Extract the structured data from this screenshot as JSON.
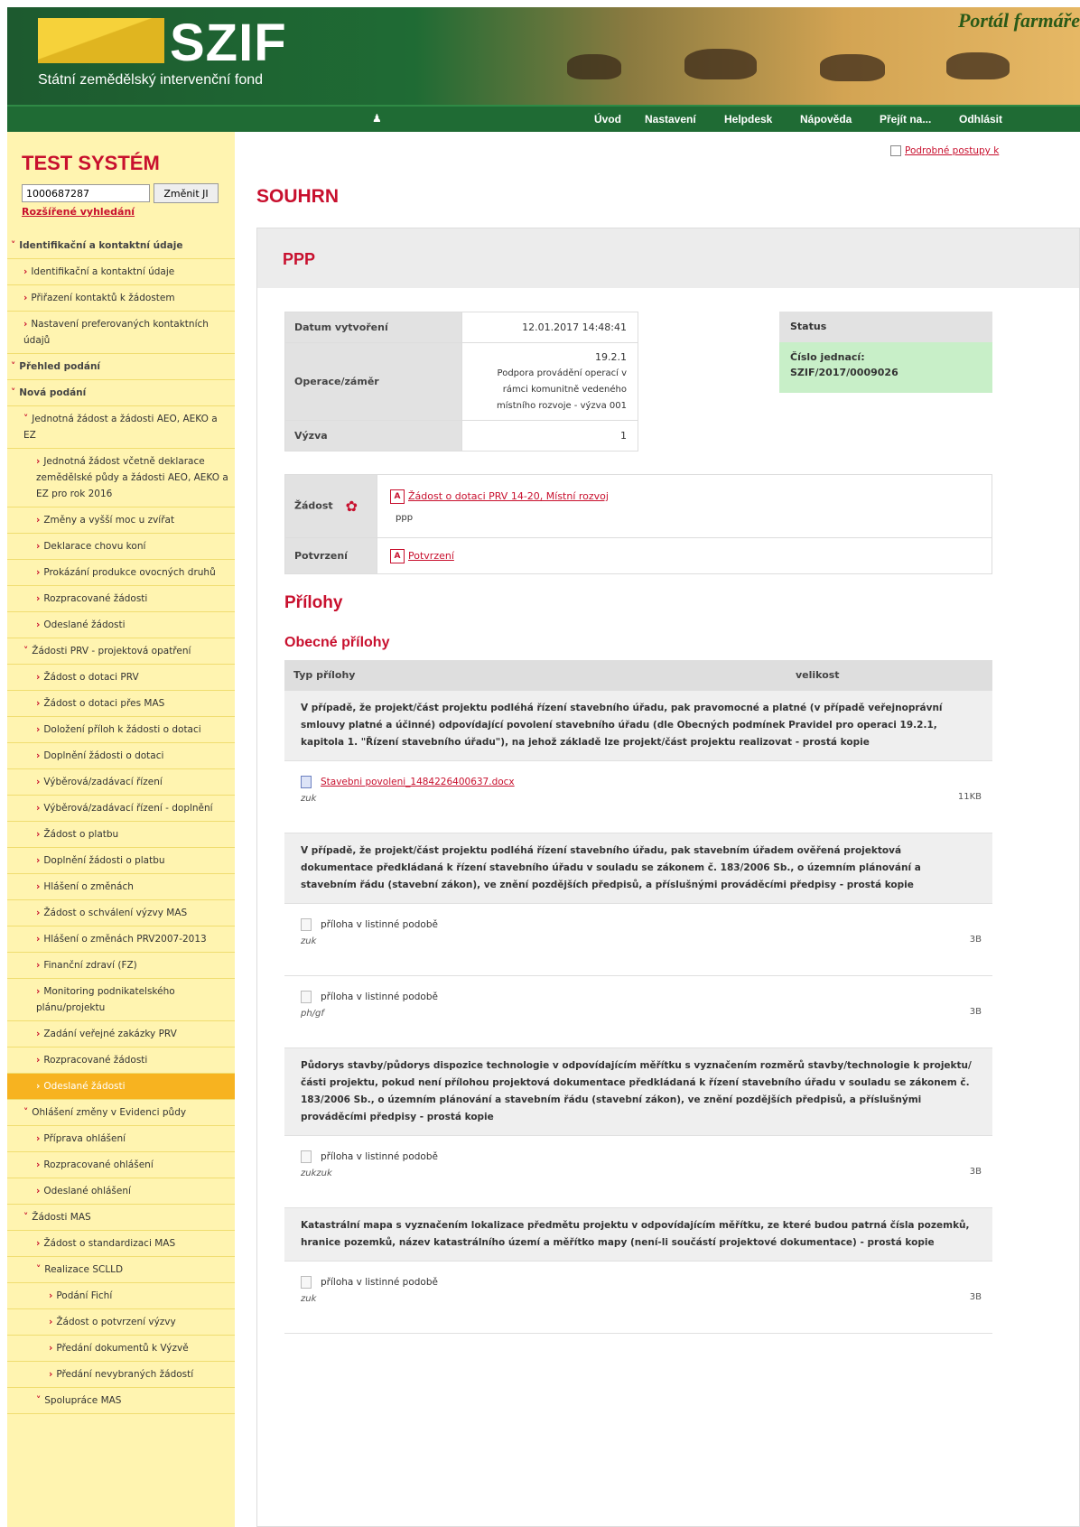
{
  "header": {
    "logo": "SZIF",
    "logo_subtitle": "Státní zemědělský intervenční fond",
    "portal_title": "Portál farmáře"
  },
  "nav": {
    "items": [
      "Úvod",
      "Nastavení",
      "Helpdesk",
      "Nápověda",
      "Přejít na...",
      "Odhlásit"
    ]
  },
  "sidebar": {
    "title": "TEST SYSTÉM",
    "id_value": "1000687287",
    "change_button": "Změnit JI",
    "advanced_search": "Rozšířené vyhledání",
    "menu": [
      {
        "label": "Identifikační a kontaktní údaje",
        "level": 0,
        "chev": "v",
        "active": false
      },
      {
        "label": "Identifikační a kontaktní údaje",
        "level": 1,
        "chev": ">",
        "active": false
      },
      {
        "label": "Přiřazení kontaktů k žádostem",
        "level": 1,
        "chev": ">",
        "active": false
      },
      {
        "label": "Nastavení preferovaných kontaktních údajů",
        "level": 1,
        "chev": ">",
        "active": false
      },
      {
        "label": "Přehled podání",
        "level": 0,
        "chev": "v",
        "active": false
      },
      {
        "label": "Nová podání",
        "level": 0,
        "chev": "v",
        "active": false
      },
      {
        "label": "Jednotná žádost a žádosti AEO, AEKO a EZ",
        "level": 1,
        "chev": "v",
        "active": false
      },
      {
        "label": "Jednotná žádost včetně deklarace zemědělské půdy a žádosti AEO, AEKO a EZ pro rok 2016",
        "level": 2,
        "chev": ">",
        "active": false
      },
      {
        "label": "Změny a vyšší moc u zvířat",
        "level": 2,
        "chev": ">",
        "active": false
      },
      {
        "label": "Deklarace chovu koní",
        "level": 2,
        "chev": ">",
        "active": false
      },
      {
        "label": "Prokázání produkce ovocných druhů",
        "level": 2,
        "chev": ">",
        "active": false
      },
      {
        "label": "Rozpracované žádosti",
        "level": 2,
        "chev": ">",
        "active": false
      },
      {
        "label": "Odeslané žádosti",
        "level": 2,
        "chev": ">",
        "active": false
      },
      {
        "label": "Žádosti PRV - projektová opatření",
        "level": 1,
        "chev": "v",
        "active": false
      },
      {
        "label": "Žádost o dotaci PRV",
        "level": 2,
        "chev": ">",
        "active": false
      },
      {
        "label": "Žádost o dotaci přes MAS",
        "level": 2,
        "chev": ">",
        "active": false
      },
      {
        "label": "Doložení příloh k žádosti o dotaci",
        "level": 2,
        "chev": ">",
        "active": false
      },
      {
        "label": "Doplnění žádosti o dotaci",
        "level": 2,
        "chev": ">",
        "active": false
      },
      {
        "label": "Výběrová/zadávací řízení",
        "level": 2,
        "chev": ">",
        "active": false
      },
      {
        "label": "Výběrová/zadávací řízení - doplnění",
        "level": 2,
        "chev": ">",
        "active": false
      },
      {
        "label": "Žádost o platbu",
        "level": 2,
        "chev": ">",
        "active": false
      },
      {
        "label": "Doplnění žádosti o platbu",
        "level": 2,
        "chev": ">",
        "active": false
      },
      {
        "label": "Hlášení o změnách",
        "level": 2,
        "chev": ">",
        "active": false
      },
      {
        "label": "Žádost o schválení výzvy MAS",
        "level": 2,
        "chev": ">",
        "active": false
      },
      {
        "label": "Hlášení o změnách PRV2007-2013",
        "level": 2,
        "chev": ">",
        "active": false
      },
      {
        "label": "Finanční zdraví (FZ)",
        "level": 2,
        "chev": ">",
        "active": false
      },
      {
        "label": "Monitoring podnikatelského plánu/projektu",
        "level": 2,
        "chev": ">",
        "active": false
      },
      {
        "label": "Zadání veřejné zakázky PRV",
        "level": 2,
        "chev": ">",
        "active": false
      },
      {
        "label": "Rozpracované žádosti",
        "level": 2,
        "chev": ">",
        "active": false
      },
      {
        "label": "Odeslané žádosti",
        "level": 2,
        "chev": ">",
        "active": true
      },
      {
        "label": "Ohlášení změny v Evidenci půdy",
        "level": 1,
        "chev": "v",
        "active": false
      },
      {
        "label": "Příprava ohlášení",
        "level": 2,
        "chev": ">",
        "active": false
      },
      {
        "label": "Rozpracované ohlášení",
        "level": 2,
        "chev": ">",
        "active": false
      },
      {
        "label": "Odeslané ohlášení",
        "level": 2,
        "chev": ">",
        "active": false
      },
      {
        "label": "Žádosti MAS",
        "level": 1,
        "chev": "v",
        "active": false
      },
      {
        "label": "Žádost o standardizaci MAS",
        "level": 2,
        "chev": ">",
        "active": false
      },
      {
        "label": "Realizace SCLLD",
        "level": 2,
        "chev": "v",
        "active": false
      },
      {
        "label": "Podání Fichí",
        "level": 3,
        "chev": ">",
        "active": false
      },
      {
        "label": "Žádost o potvrzení výzvy",
        "level": 3,
        "chev": ">",
        "active": false
      },
      {
        "label": "Předání dokumentů k Výzvě",
        "level": 3,
        "chev": ">",
        "active": false
      },
      {
        "label": "Předání nevybraných žádostí",
        "level": 3,
        "chev": ">",
        "active": false
      },
      {
        "label": "Spolupráce MAS",
        "level": 2,
        "chev": "v",
        "active": false
      }
    ]
  },
  "main": {
    "detail_link": "Podrobné postupy k",
    "page_title": "SOUHRN",
    "panel_title": "PPP",
    "info": {
      "datum_label": "Datum vytvoření",
      "datum_value": "12.01.2017 14:48:41",
      "operace_label": "Operace/záměr",
      "operace_code": "19.2.1",
      "operace_l1": "Podpora provádění operací v",
      "operace_l2": "rámci komunitně vedeného",
      "operace_l3": "místního rozvoje - výzva 001",
      "vyzva_label": "Výzva",
      "vyzva_value": "1"
    },
    "status": {
      "header": "Status",
      "line1": "Číslo jednací:",
      "line2": "SZIF/2017/0009026"
    },
    "docs": {
      "zadost_label": "Žádost",
      "zadost_link": "Žádost o dotaci PRV 14-20, Místní rozvoj",
      "zadost_note": "ppp",
      "potvrzeni_label": "Potvrzení",
      "potvrzeni_link": "Potvrzení"
    },
    "attachments_heading": "Přílohy",
    "general_heading": "Obecné přílohy",
    "table_head": {
      "type": "Typ přílohy",
      "size": "velikost"
    },
    "attachments": [
      {
        "desc": "V případě, že projekt/část projektu podléhá řízení stavebního úřadu, pak pravomocné a platné (v případě veřejnoprávní smlouvy platné a účinné) odpovídající povolení stavebního úřadu (dle Obecných podmínek Pravidel pro operaci 19.2.1, kapitola 1. \"Řízení stavebního úřadu\"), na jehož základě lze projekt/část projektu realizovat - prostá kopie",
        "files": [
          {
            "name": "Stavebni povoleni_1484226400637.docx",
            "note": "zuk",
            "size": "11KB",
            "icon": "doc"
          }
        ]
      },
      {
        "desc": "V případě, že projekt/část projektu podléhá řízení stavebního úřadu, pak stavebním úřadem ověřená projektová dokumentace předkládaná k řízení stavebního úřadu v souladu se zákonem č. 183/2006 Sb., o územním plánování a stavebním řádu (stavební zákon), ve znění pozdějších předpisů, a příslušnými prováděcími předpisy - prostá kopie",
        "files": [
          {
            "name": "příloha v listinné podobě",
            "note": "zuk",
            "size": "3B",
            "icon": "blank"
          },
          {
            "name": "příloha v listinné podobě",
            "note": "ph/gf",
            "size": "3B",
            "icon": "blank"
          }
        ]
      },
      {
        "desc": "Půdorys stavby/půdorys dispozice technologie v odpovídajícím měřítku s vyznačením rozměrů stavby/technologie k projektu/části projektu, pokud není přílohou projektová dokumentace předkládaná k řízení stavebního úřadu v souladu se zákonem č. 183/2006 Sb., o územním plánování a stavebním řádu (stavební zákon), ve znění pozdějších předpisů, a příslušnými prováděcími předpisy - prostá kopie",
        "files": [
          {
            "name": "příloha v listinné podobě",
            "note": "zukzuk",
            "size": "3B",
            "icon": "blank"
          }
        ]
      },
      {
        "desc": "Katastrální mapa s vyznačením lokalizace předmětu projektu v odpovídajícím měřítku, ze které budou patrná čísla pozemků, hranice pozemků, název katastrálního území a měřítko mapy (není-li součástí projektové dokumentace) - prostá kopie",
        "files": [
          {
            "name": "příloha v listinné podobě",
            "note": "zuk",
            "size": "3B",
            "icon": "blank"
          }
        ]
      }
    ]
  }
}
